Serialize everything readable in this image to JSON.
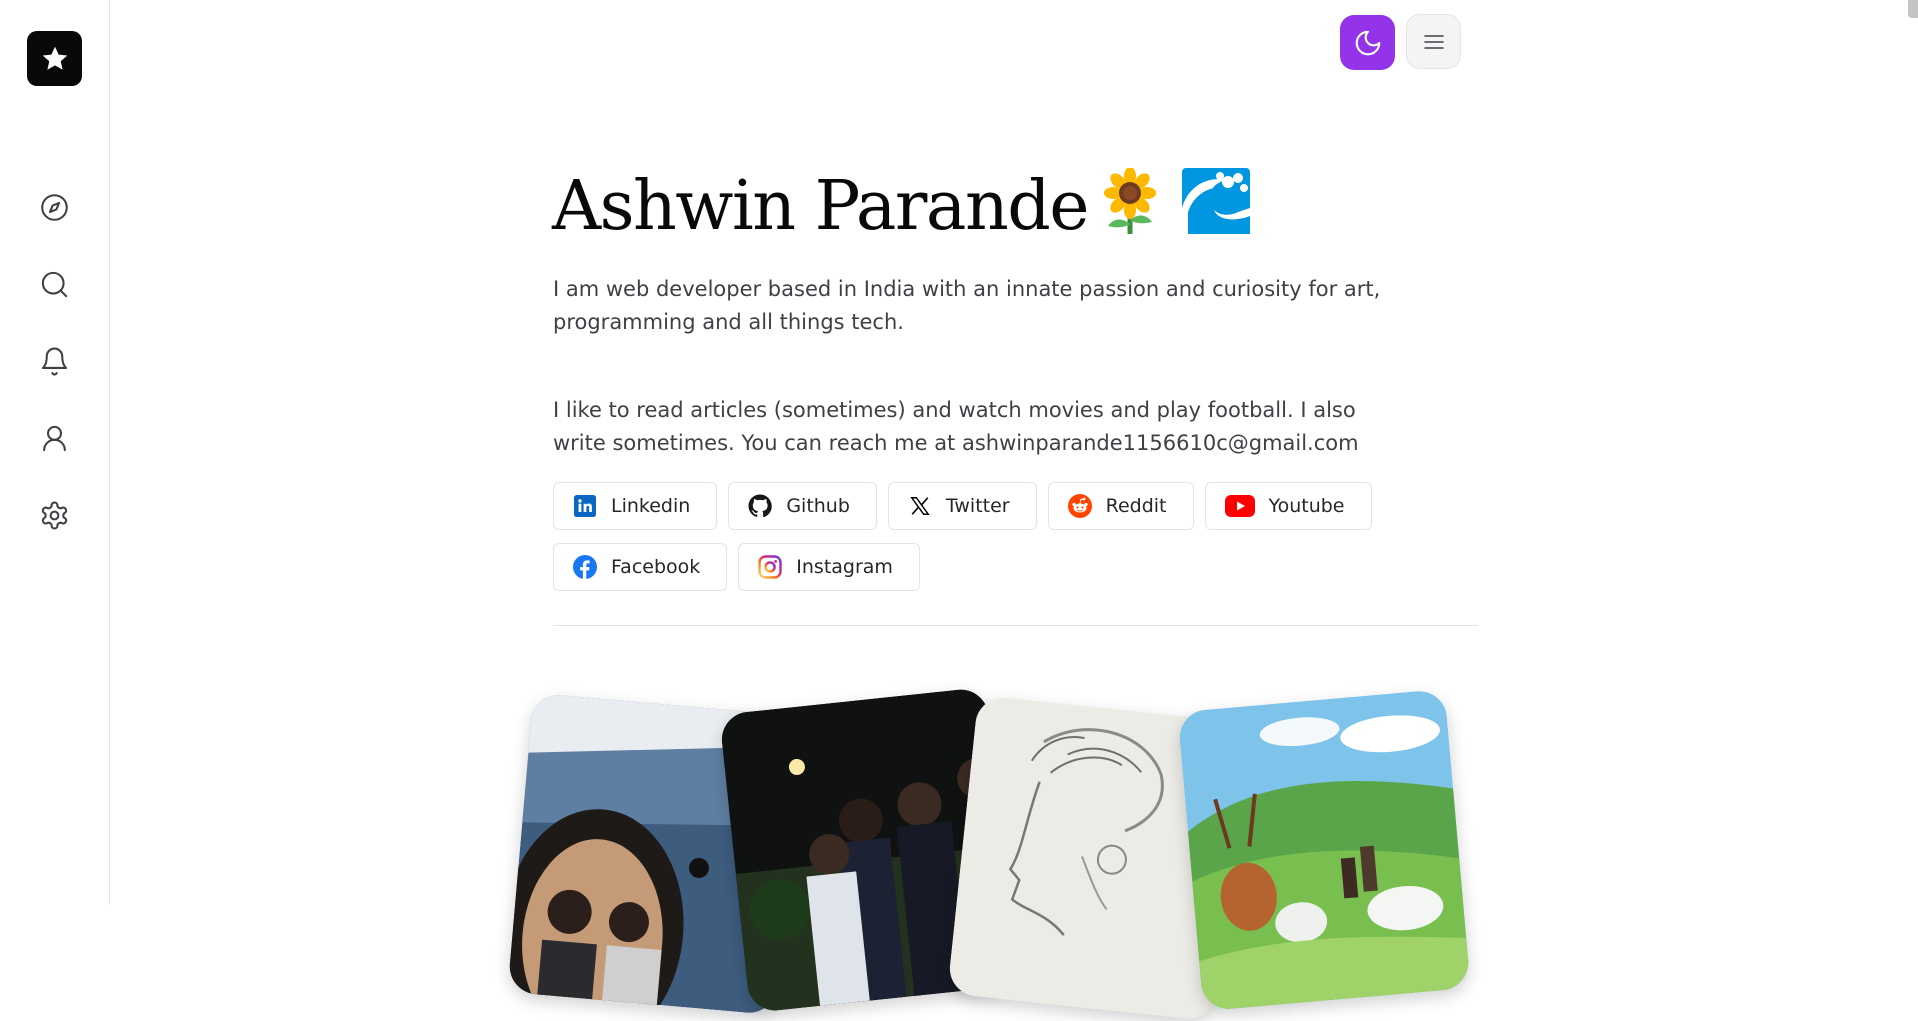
{
  "profile": {
    "name": "Ashwin Parande",
    "emojis": [
      "sunflower",
      "wave"
    ],
    "bio_1": "I am web developer based in India with an innate passion and curiosity for art, programming and all things tech.",
    "bio_2": "I like to read articles (sometimes) and watch movies and play football. I also write sometimes. You can reach me at ashwinparande1156610c@gmail.com"
  },
  "sidebar": {
    "logo_icon": "star-icon",
    "items": [
      {
        "icon": "compass-icon"
      },
      {
        "icon": "search-icon"
      },
      {
        "icon": "bell-icon"
      },
      {
        "icon": "user-icon"
      },
      {
        "icon": "gear-icon"
      }
    ]
  },
  "header": {
    "theme_icon": "moon-icon",
    "menu_icon": "hamburger-menu-icon",
    "accent": "#9333ea"
  },
  "socials": [
    {
      "label": "Linkedin",
      "icon": "linkedin-icon",
      "color": "#0a66c2"
    },
    {
      "label": "Github",
      "icon": "github-icon",
      "color": "#181717"
    },
    {
      "label": "Twitter",
      "icon": "x-icon",
      "color": "#000000"
    },
    {
      "label": "Reddit",
      "icon": "reddit-icon",
      "color": "#ff4500"
    },
    {
      "label": "Youtube",
      "icon": "youtube-icon",
      "color": "#ff0000"
    },
    {
      "label": "Facebook",
      "icon": "facebook-icon",
      "color": "#1877f2"
    },
    {
      "label": "Instagram",
      "icon": "instagram-icon",
      "color": "#e1306c"
    }
  ],
  "gallery": [
    {
      "name": "photo-friends-mirror-selfie"
    },
    {
      "name": "photo-friends-night"
    },
    {
      "name": "photo-pencil-sketch"
    },
    {
      "name": "photo-anime-landscape"
    }
  ]
}
